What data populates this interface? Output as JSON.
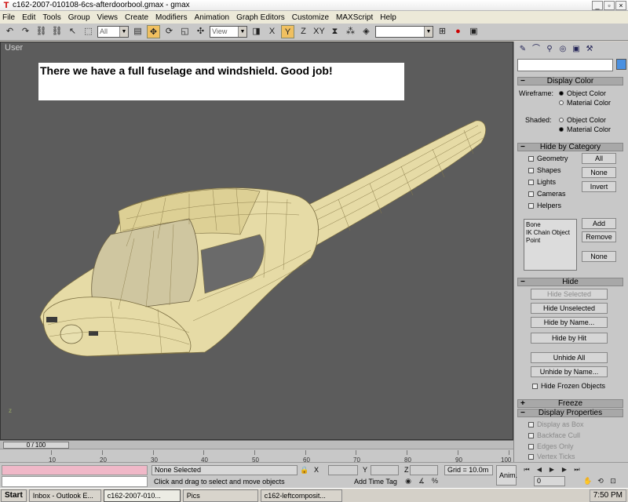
{
  "window": {
    "title": "c162-2007-010108-6cs-afterdoorbool.gmax - gmax"
  },
  "menu": [
    "File",
    "Edit",
    "Tools",
    "Group",
    "Views",
    "Create",
    "Modifiers",
    "Animation",
    "Graph Editors",
    "Customize",
    "MAXScript",
    "Help"
  ],
  "toolbar": {
    "selection_filter": "All",
    "coord_system": "View"
  },
  "viewport": {
    "label": "User",
    "caption": "There we have a full fuselage and windshield.  Good job!",
    "axis_label": "z",
    "model_color": "#e6dba6"
  },
  "panel": {
    "display_color": {
      "title": "Display Color",
      "wireframe_label": "Wireframe:",
      "shaded_label": "Shaded:",
      "opt_object": "Object Color",
      "opt_material": "Material Color"
    },
    "hide_by_category": {
      "title": "Hide by Category",
      "items": [
        "Geometry",
        "Shapes",
        "Lights",
        "Cameras",
        "Helpers"
      ],
      "buttons": [
        "All",
        "None",
        "Invert"
      ],
      "list": [
        "Bone",
        "IK Chain Object",
        "Point"
      ],
      "list_buttons": [
        "Add",
        "Remove",
        "None"
      ]
    },
    "hide": {
      "title": "Hide",
      "buttons": [
        "Hide Selected",
        "Hide Unselected",
        "Hide by Name...",
        "Hide by Hit",
        "Unhide All",
        "Unhide by Name..."
      ],
      "frozen_label": "Hide Frozen Objects"
    },
    "freeze": {
      "title": "Freeze"
    },
    "display_properties": {
      "title": "Display Properties",
      "items": [
        "Display as Box",
        "Backface Cull",
        "Edges Only",
        "Vertex Ticks"
      ]
    }
  },
  "timeline": {
    "frame": "0 / 100",
    "ticks": [
      "10",
      "20",
      "30",
      "40",
      "50",
      "60",
      "70",
      "80",
      "90",
      "100"
    ]
  },
  "status": {
    "selection": "None Selected",
    "prompt": "Click and drag to select and move objects",
    "x_label": "X",
    "y_label": "Y",
    "z_label": "Z",
    "grid": "Grid = 10.0m",
    "add_time_tag": "Add Time Tag",
    "anim": "Anim.",
    "frame_field": "0"
  },
  "taskbar": {
    "start": "Start",
    "tasks": [
      "Inbox - Outlook E...",
      "c162-2007-010...",
      "Pics",
      "c162-leftcomposit..."
    ],
    "clock": "7:50 PM"
  }
}
